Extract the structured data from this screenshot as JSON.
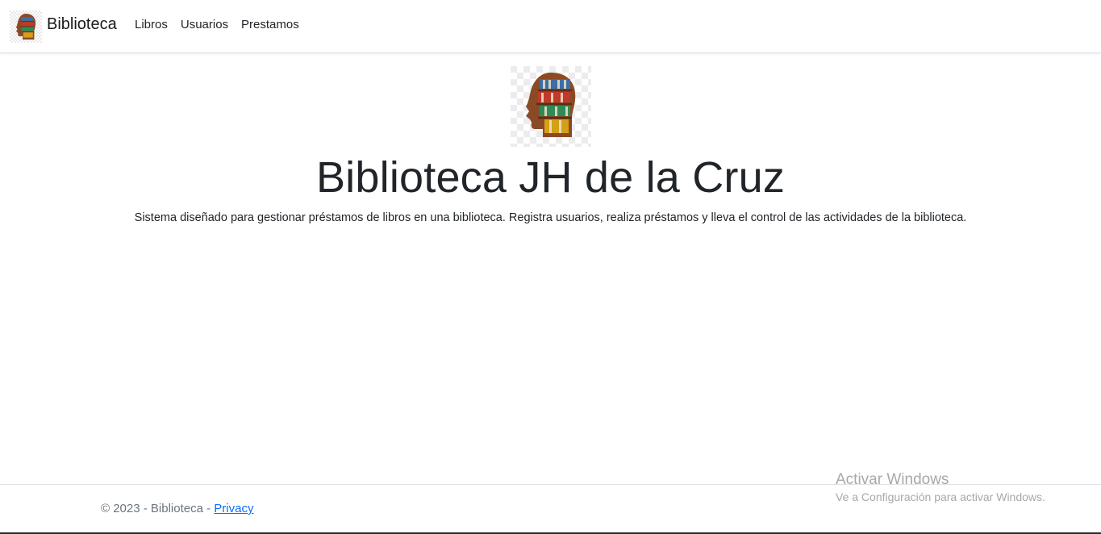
{
  "navbar": {
    "brand": "Biblioteca",
    "brand_logo_icon": "head-bookshelf-icon",
    "links": [
      "Libros",
      "Usuarios",
      "Prestamos"
    ]
  },
  "hero": {
    "logo_icon": "head-bookshelf-icon",
    "title": "Biblioteca JH de la Cruz",
    "description": "Sistema diseñado para gestionar préstamos de libros en una biblioteca. Registra usuarios, realiza préstamos y lleva el control de las actividades de la biblioteca."
  },
  "footer": {
    "text": "© 2023 - Biblioteca - ",
    "privacy_link": "Privacy"
  },
  "watermark": {
    "title": "Activar Windows",
    "subtitle": "Ve a Configuración para activar Windows."
  },
  "colors": {
    "link": "#0d6efd",
    "text": "#212529",
    "muted": "#6c757d",
    "shelf_wood": "#8b4a26"
  }
}
